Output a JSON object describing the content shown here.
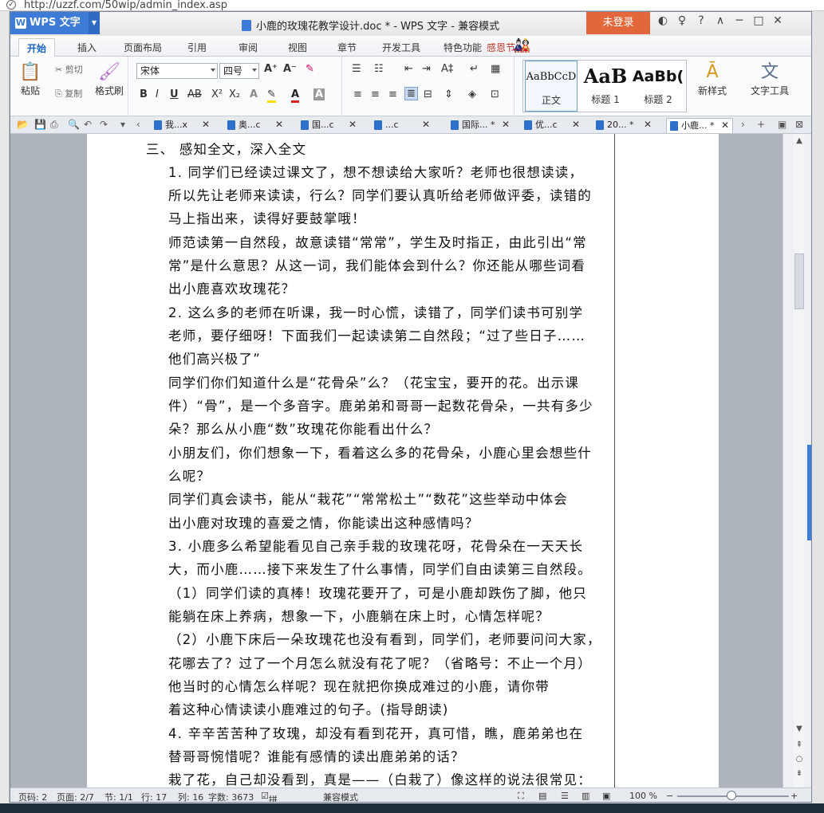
{
  "browser": {
    "url": "http://uzzf.com/50wip/admin_index.asp"
  },
  "app": {
    "name": "WPS 文字",
    "doc_title": "小鹿的玫瑰花教学设计.doc * - WPS 文字 - 兼容模式",
    "login": "未登录",
    "controls": [
      "◐",
      "♀",
      "?",
      "∧",
      "─",
      "□",
      "✕"
    ]
  },
  "menu": [
    "开始",
    "插入",
    "页面布局",
    "引用",
    "审阅",
    "视图",
    "章节",
    "开发工具",
    "特色功能",
    "感恩节"
  ],
  "ribbon": {
    "paste": "粘贴",
    "cut": "剪切",
    "copy": "复制",
    "format_painter": "格式刷",
    "font_name": "宋体",
    "font_size": "四号",
    "bold": "B",
    "italic": "I",
    "underline": "U",
    "strike": "AB",
    "styles": [
      {
        "sample": "AaBbCcD",
        "name": "正文"
      },
      {
        "sample": "AaB",
        "name": "标题 1"
      },
      {
        "sample": "AaBb(",
        "name": "标题 2"
      }
    ],
    "new_style": "新样式",
    "text_tools": "文字工具"
  },
  "doc_tabs": [
    "我...x",
    "奥...c",
    "国...c",
    "...c",
    "国际... *",
    "优...c",
    "20... *",
    "小鹿... *"
  ],
  "document": {
    "lines": [
      "三、   感知全文，深入全文",
      "1.   同学们已经读过课文了，想不想读给大家听？老师也很想读读，",
      "所以先让老师来读读，行么？同学们要认真听给老师做评委，读错的",
      "马上指出来，读得好要鼓掌哦！",
      "师范读第一自然段，故意读错“常常”，学生及时指正，由此引出“常",
      "常”是什么意思？从这一词，我们能体会到什么？你还能从哪些词看",
      "出小鹿喜欢玫瑰花？",
      "2. 这么多的老师在听课，我一时心慌，读错了，同学们读书可别学",
      "老师，要仔细呀！下面我们一起读读第二自然段；“过了些日子……",
      "他们高兴极了”",
      "同学们你们知道什么是“花骨朵”么？（花宝宝，要开的花。出示课",
      "件）“骨”，是一个多音字。鹿弟弟和哥哥一起数花骨朵，一共有多少",
      "朵？那么从小鹿“数”玫瑰花你能看出什么？",
      "小朋友们，你们想象一下，看着这么多的花骨朵，小鹿心里会想些什",
      "么呢？",
      "同学们真会读书，能从“栽花”“常常松土”“数花”这些举动中体会",
      "出小鹿对玫瑰的喜爱之情，你能读出这种感情吗？",
      "3. 小鹿多么希望能看见自己亲手栽的玫瑰花呀，花骨朵在一天天长",
      "大，而小鹿……接下来发生了什么事情，同学们自由读第三自然段。",
      "（1）同学们读的真棒！玫瑰花要开了，可是小鹿却跌伤了脚，他只",
      "能躺在床上养病，想象一下，小鹿躺在床上时，心情怎样呢？",
      "（2）小鹿下床后一朵玫瑰花也没有看到，同学们，老师要问问大家，",
      "花哪去了？过了一个月怎么就没有花了呢？（省略号：不止一个月）",
      "      他当时的心情怎么样呢？现在就把你换成难过的小鹿，请你带",
      "着这种心情读读小鹿难过的句子。(指导朗读)",
      "4. 辛辛苦苦种了玫瑰，却没有看到花开，真可惜，瞧，鹿弟弟也在",
      "替哥哥惋惜呢？谁能有感情的读出鹿弟弟的话？",
      "   栽了花，自己却没看到，真是——（白栽了）像这样的说法很常见："
    ]
  },
  "status": {
    "page_num": "页码: 2",
    "pages": "页面: 2/7",
    "section": "节: 1/1",
    "row": "行: 17",
    "col": "列: 16",
    "words": "字数: 3673",
    "spell": "拼写检查",
    "compat": "兼容模式",
    "zoom": "100 %"
  }
}
